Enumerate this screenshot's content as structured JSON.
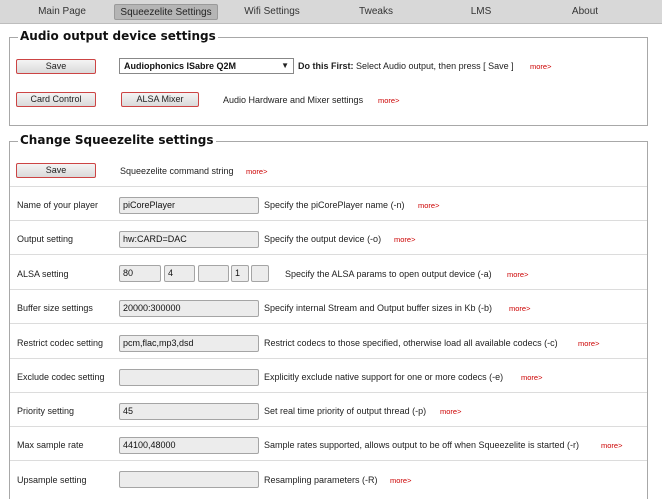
{
  "nav": {
    "tabs": [
      "Main Page",
      "Squeezelite Settings",
      "Wifi Settings",
      "Tweaks",
      "LMS",
      "About"
    ],
    "active": "Squeezelite Settings"
  },
  "audio_output": {
    "title": "Audio output device settings",
    "save_label": "Save",
    "device_selected": "Audiophonics ISabre Q2M",
    "do_first_bold": "Do this First:",
    "do_first_text": " Select Audio output, then press [ Save ]",
    "card_control_label": "Card Control",
    "alsa_mixer_label": "ALSA Mixer",
    "hw_text": "Audio Hardware and Mixer settings",
    "more": "more>"
  },
  "squeezelite": {
    "title": "Change Squeezelite settings",
    "save_label": "Save",
    "command_text": "Squeezelite command string",
    "more": "more>",
    "rows": [
      {
        "label": "Name of your player",
        "value": "piCorePlayer",
        "desc": "Specify the piCorePlayer name (-n)"
      },
      {
        "label": "Output setting",
        "value": "hw:CARD=DAC",
        "desc": "Specify the output device (-o)"
      },
      {
        "label": "ALSA setting",
        "alsa": [
          "80",
          "4",
          "",
          "1",
          ""
        ],
        "desc": "Specify the ALSA params to open output device (-a)"
      },
      {
        "label": "Buffer size settings",
        "value": "20000:300000",
        "desc": "Specify internal Stream and Output buffer sizes in Kb (-b)"
      },
      {
        "label": "Restrict codec setting",
        "value": "pcm,flac,mp3,dsd",
        "desc": "Restrict codecs to those specified, otherwise load all available codecs (-c)"
      },
      {
        "label": "Exclude codec setting",
        "value": "",
        "desc": "Explicitly exclude native support for one or more codecs (-e)"
      },
      {
        "label": "Priority setting",
        "value": "45",
        "desc": "Set real time priority of output thread (-p)"
      },
      {
        "label": "Max sample rate",
        "value": "44100,48000",
        "desc": "Sample rates supported, allows output to be off when Squeezelite is started (-r)"
      },
      {
        "label": "Upsample setting",
        "value": "",
        "desc": "Resampling parameters (-R)"
      }
    ]
  }
}
